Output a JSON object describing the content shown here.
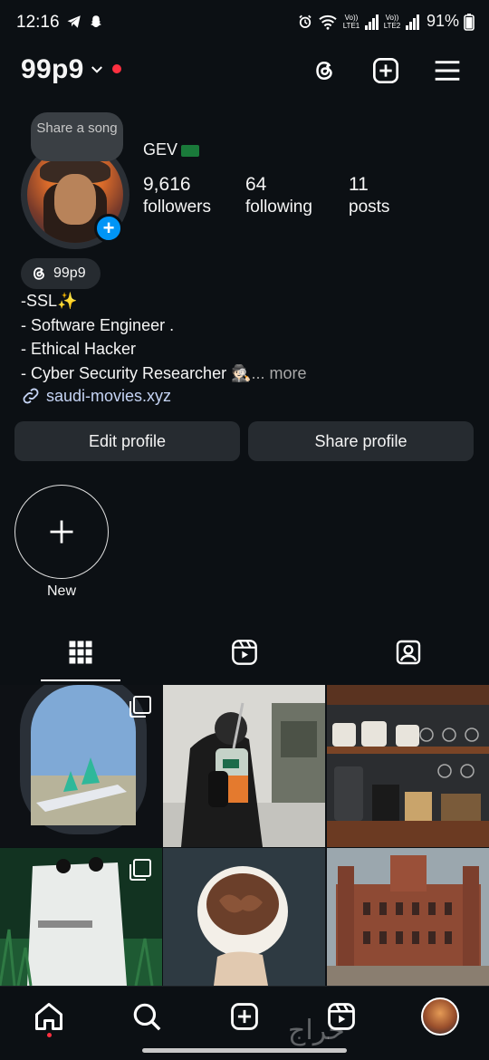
{
  "status_bar": {
    "time": "12:16",
    "battery": "91%",
    "sim1": "Vo)) LTE1",
    "sim2": "Vo)) LTE2"
  },
  "header": {
    "username": "99p9",
    "icons": [
      "threads-icon",
      "create-plus-icon",
      "menu-icon"
    ]
  },
  "profile": {
    "song_prompt": "Share a song",
    "display_name": "GEV",
    "stats": [
      {
        "value": "9,616",
        "label": "followers"
      },
      {
        "value": "64",
        "label": "following"
      },
      {
        "value": "11",
        "label": "posts"
      }
    ],
    "threads_badge": "99p9",
    "bio": [
      "-SSL✨",
      "- Software Engineer .",
      "- Ethical Hacker",
      "- Cyber Security Researcher 🕵🏻"
    ],
    "bio_more": "... more",
    "link": "saudi-movies.xyz",
    "edit_button": "Edit profile",
    "share_button": "Share profile"
  },
  "highlights": {
    "new_label": "New"
  },
  "tabs": [
    "grid-icon",
    "reels-icon",
    "tagged-icon"
  ],
  "grid": [
    {
      "subject": "airplane window with green-tailed aircraft",
      "multi": true
    },
    {
      "subject": "person holding iced drink",
      "multi": false
    },
    {
      "subject": "coffee bar shelf with mugs",
      "multi": false
    },
    {
      "subject": "coffee bag in grass",
      "multi": true
    },
    {
      "subject": "cup of chocolate dessert",
      "multi": false
    },
    {
      "subject": "historic brick palace",
      "multi": false
    }
  ],
  "bottom_nav": [
    "home-icon",
    "search-icon",
    "create-icon",
    "reels-icon",
    "profile-avatar"
  ],
  "watermark": "حراج",
  "colors": {
    "background": "#0c1014",
    "button": "#262b30",
    "accent_blue": "#0095f6",
    "notification_red": "#ff3040",
    "link": "#c5d4f5"
  }
}
